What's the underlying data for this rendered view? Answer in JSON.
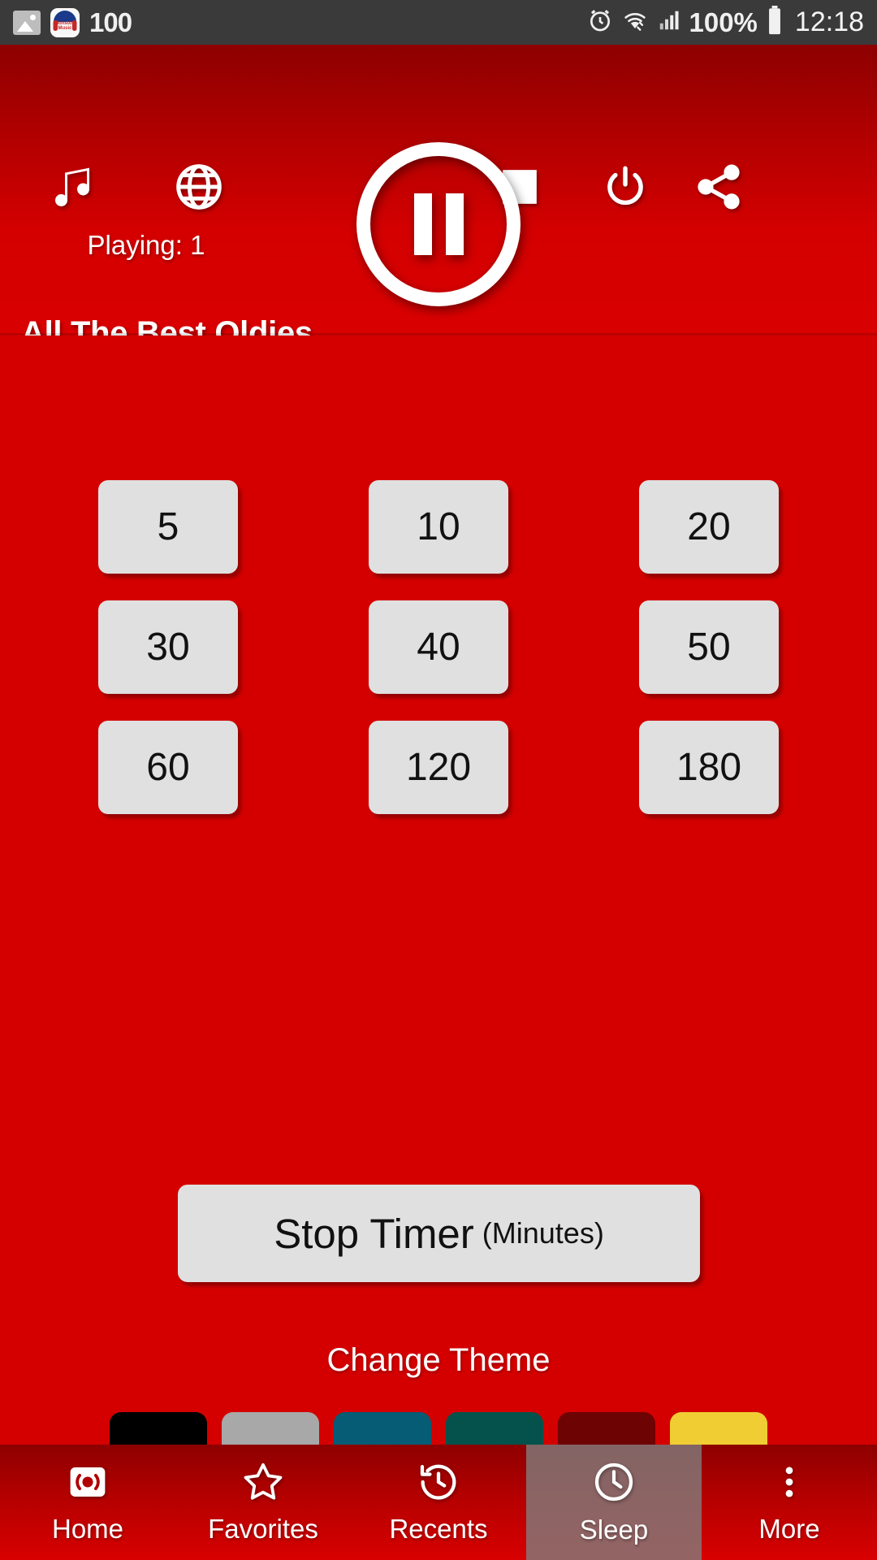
{
  "statusbar": {
    "image_icon": "image-icon",
    "app_icon": "nonstop-music-app-icon",
    "app_icon_text": "Nonstop Music",
    "notification_count": "100",
    "alarm_icon": "alarm-clock-icon",
    "wifi_icon": "wifi-icon",
    "signal_icon": "cellular-signal-icon",
    "battery_pct": "100%",
    "battery_icon": "battery-full-icon",
    "time": "12:18"
  },
  "header": {
    "music_icon": "music-note-icon",
    "globe_icon": "globe-icon",
    "playing_label": "Playing: 1",
    "playpause_icon": "pause-circle-icon",
    "stop_icon": "stop-square-icon",
    "power_icon": "power-icon",
    "share_icon": "share-icon",
    "station_title": "All The Best Oldies"
  },
  "main": {
    "timer_rows": [
      [
        "5",
        "10",
        "20"
      ],
      [
        "30",
        "40",
        "50"
      ],
      [
        "60",
        "120",
        "180"
      ]
    ],
    "stop_timer": {
      "label": "Stop Timer",
      "unit": "(Minutes)"
    },
    "theme_label": "Change Theme",
    "themes": [
      {
        "name": "black",
        "color": "#000000"
      },
      {
        "name": "gray",
        "color": "#a8a8a8"
      },
      {
        "name": "teal",
        "color": "#055c74"
      },
      {
        "name": "green",
        "color": "#04524b"
      },
      {
        "name": "maroon",
        "color": "#6e0303"
      },
      {
        "name": "yellow",
        "color": "#f0ce33"
      }
    ]
  },
  "bottomnav": {
    "items": [
      {
        "label": "Home",
        "icon": "radio-broadcast-icon",
        "active": false
      },
      {
        "label": "Favorites",
        "icon": "star-icon",
        "active": false
      },
      {
        "label": "Recents",
        "icon": "history-clock-icon",
        "active": false
      },
      {
        "label": "Sleep",
        "icon": "clock-icon",
        "active": true
      },
      {
        "label": "More",
        "icon": "more-vertical-icon",
        "active": false
      }
    ]
  },
  "colors": {
    "background": "#d40000",
    "statusbar": "#3a3a3a",
    "button_face": "#e0e0e0",
    "active_tab": "#808080"
  }
}
